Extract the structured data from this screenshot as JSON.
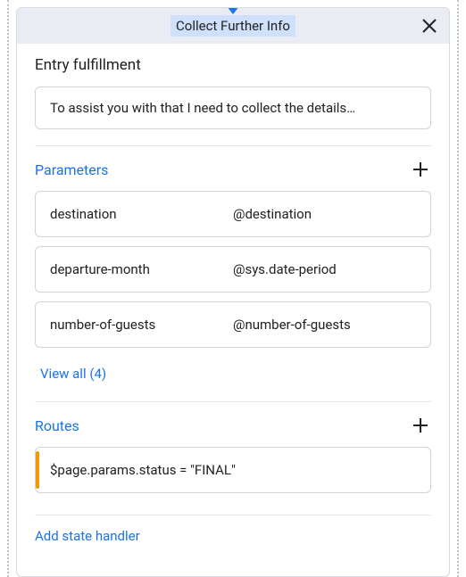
{
  "header": {
    "title": "Collect Further Info"
  },
  "entry": {
    "title": "Entry fulfillment",
    "text": "To assist you with that I need to collect the details…"
  },
  "parameters": {
    "title": "Parameters",
    "rows": [
      {
        "name": "destination",
        "type": "@destination"
      },
      {
        "name": "departure-month",
        "type": "@sys.date-period"
      },
      {
        "name": "number-of-guests",
        "type": "@number-of-guests"
      }
    ],
    "view_all": "View all (4)"
  },
  "routes": {
    "title": "Routes",
    "items": [
      {
        "condition": "$page.params.status = \"FINAL\""
      }
    ]
  },
  "add_state_handler": "Add state handler"
}
